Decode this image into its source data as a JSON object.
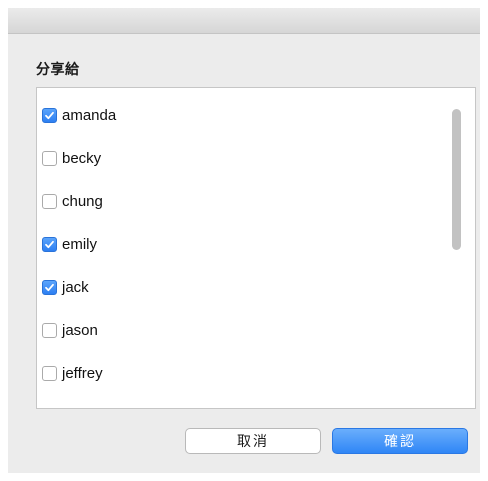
{
  "dialog": {
    "section_label": "分享給",
    "items": [
      {
        "label": "amanda",
        "checked": true
      },
      {
        "label": "becky",
        "checked": false
      },
      {
        "label": "chung",
        "checked": false
      },
      {
        "label": "emily",
        "checked": true
      },
      {
        "label": "jack",
        "checked": true
      },
      {
        "label": "jason",
        "checked": false
      },
      {
        "label": "jeffrey",
        "checked": false
      }
    ],
    "cancel_label": "取消",
    "confirm_label": "確認"
  },
  "colors": {
    "accent": "#2f86f6",
    "background": "#ececec"
  }
}
